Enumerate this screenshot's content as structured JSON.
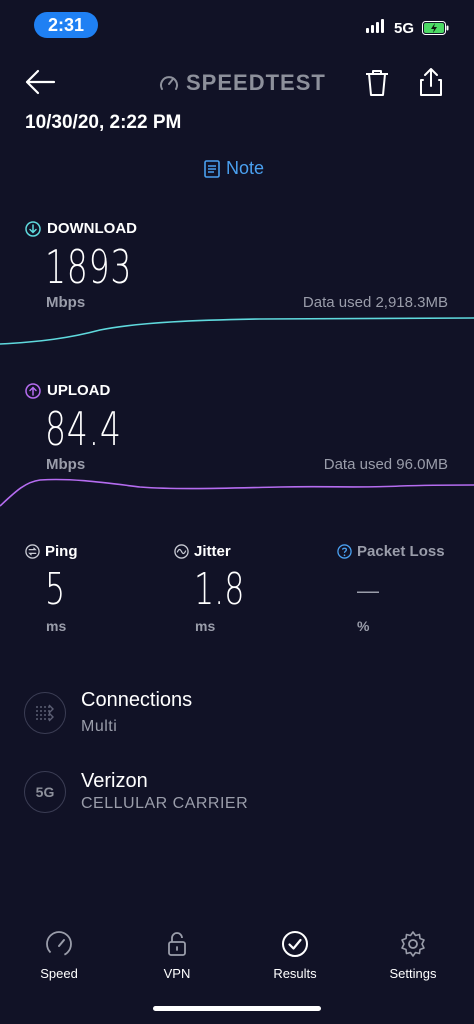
{
  "status_bar": {
    "time": "2:31",
    "network": "5G"
  },
  "header": {
    "brand": "SPEEDTEST",
    "datetime": "10/30/20, 2:22 PM",
    "note": "Note"
  },
  "download": {
    "label": "DOWNLOAD",
    "value": "1893",
    "unit": "Mbps",
    "data_used": "Data used 2,918.3MB",
    "color": "#5fd9dd"
  },
  "upload": {
    "label": "UPLOAD",
    "value": "84.4",
    "unit": "Mbps",
    "data_used": "Data used 96.0MB",
    "color": "#b56cf0"
  },
  "stats": {
    "ping": {
      "label": "Ping",
      "value": "5",
      "unit": "ms"
    },
    "jitter": {
      "label": "Jitter",
      "value": "1.8",
      "unit": "ms"
    },
    "packet_loss": {
      "label": "Packet Loss",
      "value": "—",
      "unit": "%"
    }
  },
  "connections": {
    "title": "Connections",
    "value": "Multi"
  },
  "carrier": {
    "badge": "5G",
    "name": "Verizon",
    "type": "CELLULAR CARRIER"
  },
  "tabs": [
    {
      "label": "Speed",
      "icon": "speedometer-icon"
    },
    {
      "label": "VPN",
      "icon": "lock-icon"
    },
    {
      "label": "Results",
      "icon": "check-circle-icon"
    },
    {
      "label": "Settings",
      "icon": "gear-icon"
    }
  ],
  "colors": {
    "background": "#111226",
    "accent": "#4aa0f0"
  }
}
